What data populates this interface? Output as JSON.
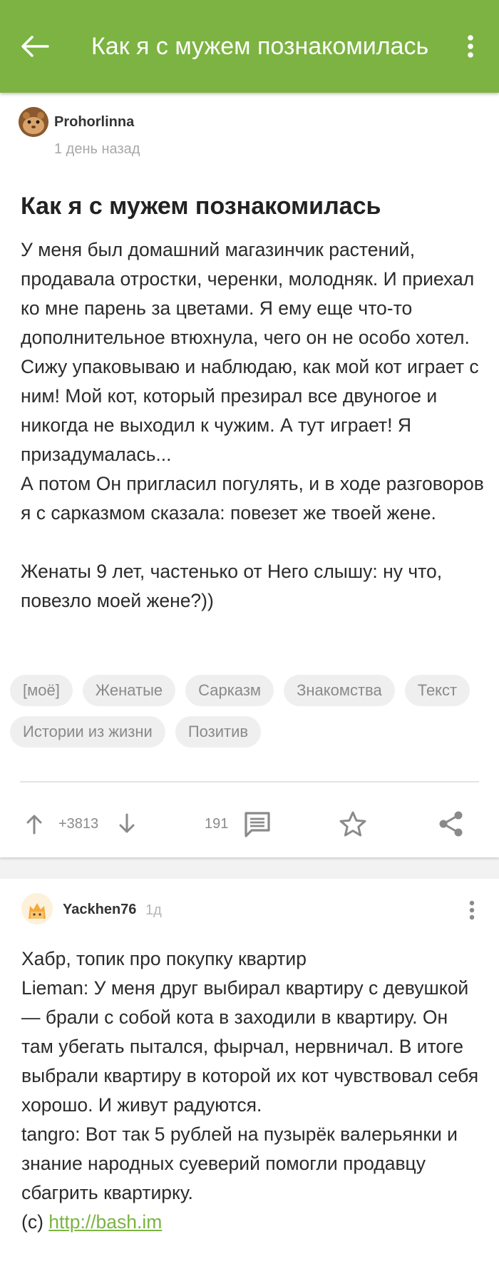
{
  "appbar": {
    "title": "Как я с мужем познакомилась",
    "accent": "#7cb342"
  },
  "post": {
    "author": "Prohorlinna",
    "time": "1 день назад",
    "title": "Как я с мужем познакомилась",
    "body": "У меня был домашний магазинчик растений, продавала отростки, черенки, молодняк. И приехал ко мне парень за цветами. Я ему еще что-то дополнительное втюхнула, чего он не особо хотел. Сижу упаковываю и наблюдаю, как мой кот играет с ним! Мой кот, который презирал все двуногое и никогда не выходил к чужим. А тут играет! Я призадумалась...\nА потом Он пригласил погулять, и в ходе разговоров я с сарказмом сказала: повезет же твоей жене.\n\nЖенаты 9 лет, частенько от Него слышу: ну что, повезло моей жене?))",
    "tags": [
      "[моё]",
      "Женатые",
      "Сарказм",
      "Знакомства",
      "Текст",
      "Истории из жизни",
      "Позитив"
    ],
    "rating": "+3813",
    "comments_count": "191"
  },
  "comment": {
    "author": "Yackhen76",
    "time": "1д",
    "lines": [
      "Хабр, топик про покупку квартир",
      "Lieman: У меня друг выбирал квартиру с девушкой — брали с собой кота в заходили в квартиру. Он там убегать пытался, фырчал, нервничал. В итоге выбрали квартиру в которой их кот чувствовал себя хорошо. И живут радуются.",
      "tangro: Вот так 5 рублей на пузырёк валерьянки и знание народных суеверий помогли продавцу сбагрить квартирку."
    ],
    "source_prefix": "(с) ",
    "source_link": "http://bash.im"
  }
}
